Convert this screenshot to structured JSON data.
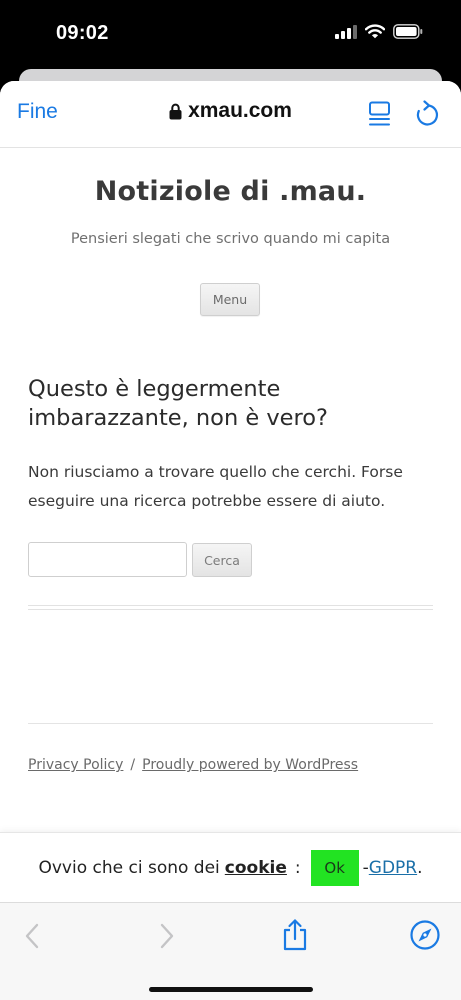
{
  "status": {
    "time": "09:02"
  },
  "nav": {
    "done_label": "Fine",
    "host": "xmau.com"
  },
  "site": {
    "title": "Notiziole di .mau.",
    "description": "Pensieri slegati che scrivo quando mi capita",
    "menu_label": "Menu"
  },
  "main": {
    "heading": "Questo è leggermente imbarazzante, non è vero?",
    "body": "Non riusciamo a trovare quello che cerchi. Forse eseguire una ricerca potrebbe essere di aiuto.",
    "search_value": "",
    "search_button": "Cerca"
  },
  "footer": {
    "privacy": "Privacy Policy",
    "separator": "/",
    "powered": "Proudly powered by WordPress"
  },
  "cookie": {
    "prefix": "Ovvio che ci sono dei",
    "link": "cookie",
    "colon": ":",
    "ok": "Ok",
    "dash": "-",
    "gdpr": "GDPR",
    "period": "."
  },
  "icons": {
    "lock": "lock-icon",
    "reader": "reader-icon",
    "reload": "reload-icon",
    "back": "chevron-left-icon",
    "forward": "chevron-right-icon",
    "share": "share-icon",
    "compass": "compass-icon",
    "recaptcha": "recaptcha-icon"
  },
  "colors": {
    "accent": "#1a7ae3",
    "ok_button": "#22e322",
    "gdpr_link": "#1a6fa8"
  }
}
